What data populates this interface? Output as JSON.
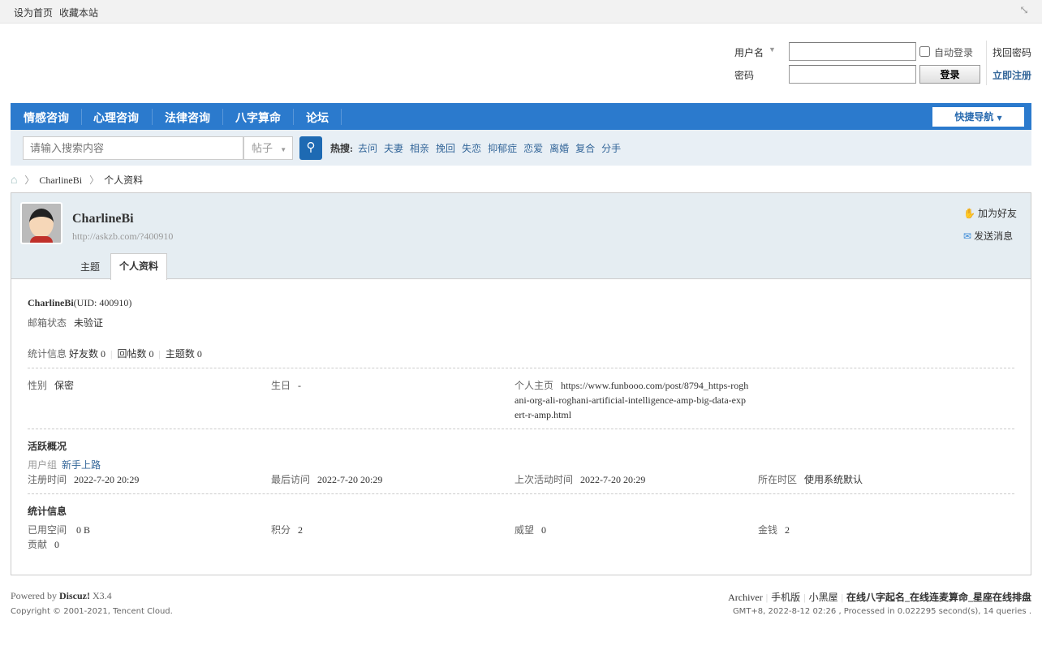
{
  "topbar": {
    "set_home": "设为首页",
    "bookmark": "收藏本站"
  },
  "login": {
    "username_label": "用户名",
    "password_label": "密码",
    "auto_login": "自动登录",
    "login_button": "登录",
    "find_password": "找回密码",
    "register": "立即注册"
  },
  "nav": {
    "items": [
      "情感咨询",
      "心理咨询",
      "法律咨询",
      "八字算命",
      "论坛"
    ],
    "quick_nav": "快捷导航"
  },
  "search": {
    "placeholder": "请输入搜索内容",
    "type": "帖子",
    "hot_label": "热搜:",
    "hot": [
      "去问",
      "夫妻",
      "相亲",
      "挽回",
      "失恋",
      "抑郁症",
      "恋爱",
      "离婚",
      "复合",
      "分手"
    ]
  },
  "breadcrumb": {
    "user": "CharlineBi",
    "page": "个人资料"
  },
  "profile": {
    "name": "CharlineBi",
    "url": "http://askzb.com/?400910",
    "add_friend": "加为好友",
    "send_message": "发送消息",
    "tabs": [
      "主题",
      "个人资料"
    ],
    "uid_line": "(UID: 400910)",
    "email_label": "邮箱状态",
    "email_value": "未验证",
    "stats_label": "统计信息",
    "friends": "好友数 0",
    "replies": "回帖数 0",
    "threads": "主题数 0",
    "gender_label": "性别",
    "gender": "保密",
    "birthday_label": "生日",
    "birthday": "-",
    "homepage_label": "个人主页",
    "homepage": "https://www.funbooo.com/post/8794_https-roghani-org-ali-roghani-artificial-intelligence-amp-big-data-expert-r-amp.html",
    "activity_title": "活跃概况",
    "group_label": "用户组",
    "group": "新手上路",
    "reg_label": "注册时间",
    "reg": "2022-7-20 20:29",
    "last_visit_label": "最后访问",
    "last_visit": "2022-7-20 20:29",
    "last_active_label": "上次活动时间",
    "last_active": "2022-7-20 20:29",
    "tz_label": "所在时区",
    "tz": "使用系统默认",
    "stats_title": "统计信息",
    "space_label": "已用空间",
    "space": "0 B",
    "points_label": "积分",
    "points": "2",
    "prestige_label": "威望",
    "prestige": "0",
    "money_label": "金钱",
    "money": "2",
    "contrib_label": "贡献",
    "contrib": "0"
  },
  "footer": {
    "powered": "Powered by",
    "discuz": "Discuz!",
    "version": "X3.4",
    "copyright": "Copyright © 2001-2021, Tencent Cloud.",
    "links": [
      "Archiver",
      "手机版",
      "小黑屋"
    ],
    "site": "在线八字起名_在线连麦算命_星座在线排盘",
    "info": "GMT+8, 2022-8-12 02:26 , Processed in 0.022295 second(s), 14 queries ."
  }
}
